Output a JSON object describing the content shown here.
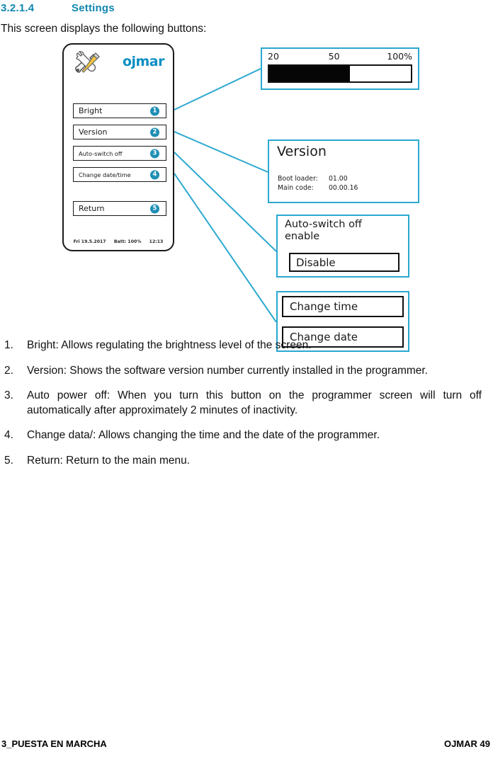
{
  "heading": {
    "number": "3.2.1.4",
    "title": "Settings"
  },
  "intro": "This screen displays the following buttons:",
  "figure": {
    "device": {
      "brand": "ojmar",
      "tools_icon": "tools-wrench-screwdriver-icon",
      "menu_items": [
        {
          "label": "Bright",
          "badge": "1"
        },
        {
          "label": "Version",
          "badge": "2"
        },
        {
          "label": "Auto-switch off",
          "badge": "3"
        },
        {
          "label": "Change date/time",
          "badge": "4"
        },
        {
          "label": "Return",
          "badge": "5"
        }
      ],
      "statusbar": {
        "date": "Fri 19.5.2017",
        "battery": "Batt:  100%",
        "time": "12:13"
      }
    },
    "panels": {
      "brightness": {
        "label_low": "20",
        "label_mid": "50",
        "label_high": "100%",
        "fill_percent": 57
      },
      "version": {
        "title": "Version",
        "boot_loader_key": "Boot loader:",
        "boot_loader_value": "01.00",
        "main_code_key": "Main code:",
        "main_code_value": "00.00.16"
      },
      "auto_switch": {
        "title": "Auto-switch off\nenable",
        "button_label": "Disable"
      },
      "change_datetime": {
        "button_time": "Change time",
        "button_date": "Change date"
      }
    },
    "connector_color": "#2aa8cf"
  },
  "list": [
    {
      "num": "1.",
      "text": "Bright: Allows regulating the brightness level of the screen."
    },
    {
      "num": "2.",
      "text": "Version: Shows the software version number currently installed in the programmer."
    },
    {
      "num": "3.",
      "text": "Auto power off: When you turn this button on the programmer screen will turn off automatically after approximately 2 minutes of inactivity."
    },
    {
      "num": "4.",
      "text": "Change data/: Allows changing the time and the date of the programmer."
    },
    {
      "num": "5.",
      "text": "Return: Return to the main menu."
    }
  ],
  "footer": {
    "left": "3_PUESTA EN MARCHA",
    "right": "OJMAR 49"
  },
  "colors": {
    "heading": "#1186b0",
    "accent": "#2aa8cf",
    "badge": "#1e8fb5",
    "brand": "#0b8ec4"
  }
}
